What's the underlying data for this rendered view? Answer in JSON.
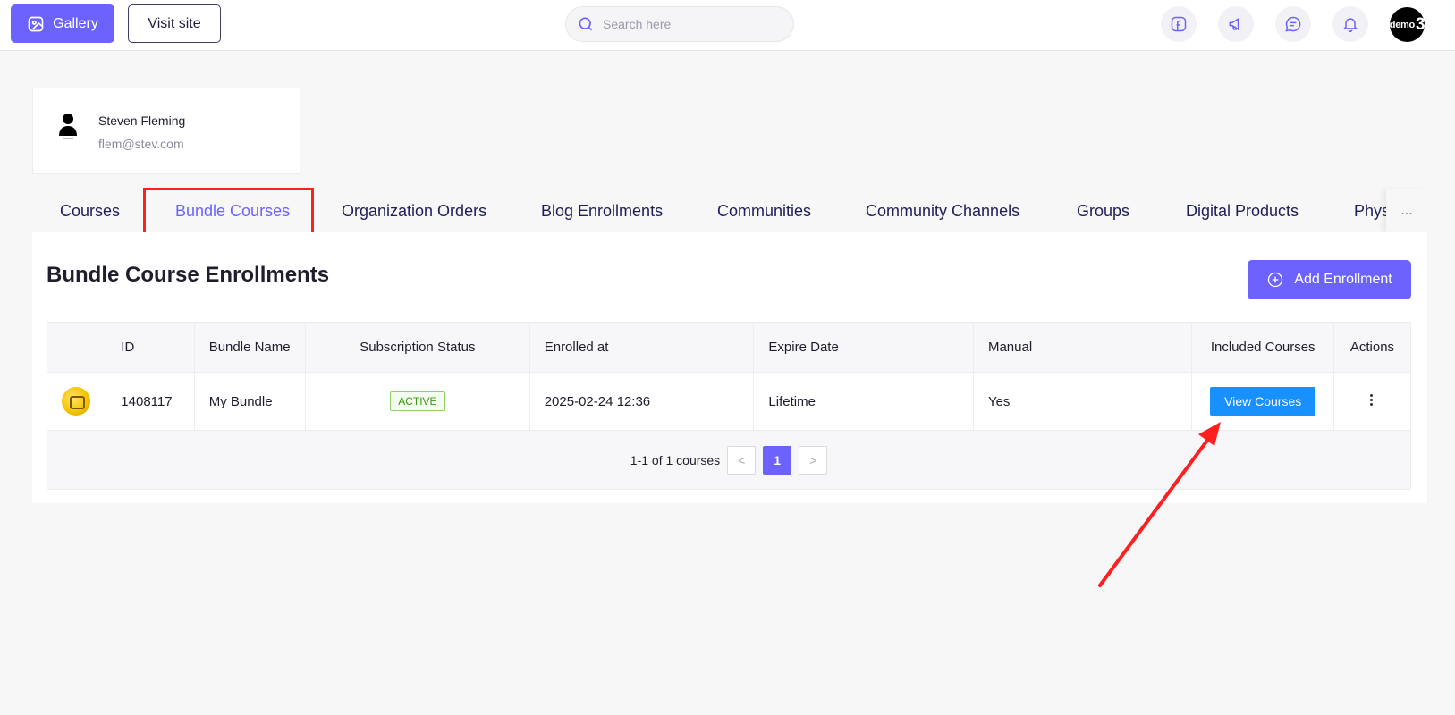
{
  "topbar": {
    "gallery_label": "Gallery",
    "visit_label": "Visit site",
    "search_placeholder": "Search here",
    "avatar_text": "demo",
    "avatar_digit": "3",
    "icons": [
      "facebook-icon",
      "megaphone-icon",
      "chat-icon",
      "bell-icon"
    ]
  },
  "user": {
    "name": "Steven Fleming",
    "email": "flem@stev.com"
  },
  "tabs": [
    {
      "label": "Courses",
      "active": false
    },
    {
      "label": "Bundle Courses",
      "active": true
    },
    {
      "label": "Organization Orders",
      "active": false
    },
    {
      "label": "Blog Enrollments",
      "active": false
    },
    {
      "label": "Communities",
      "active": false
    },
    {
      "label": "Community Channels",
      "active": false
    },
    {
      "label": "Groups",
      "active": false
    },
    {
      "label": "Digital Products",
      "active": false
    },
    {
      "label": "Phys",
      "active": false
    }
  ],
  "tabs_more": "...",
  "panel": {
    "title": "Bundle Course Enrollments",
    "add_label": "Add Enrollment"
  },
  "table": {
    "headers": [
      "",
      "ID",
      "Bundle Name",
      "Subscription Status",
      "Enrolled at",
      "Expire Date",
      "Manual",
      "Included Courses",
      "Actions"
    ],
    "rows": [
      {
        "id": "1408117",
        "bundle_name": "My Bundle",
        "status": "ACTIVE",
        "enrolled_at": "2025-02-24 12:36",
        "expire_date": "Lifetime",
        "manual": "Yes",
        "included_label": "View Courses"
      }
    ]
  },
  "pagination": {
    "summary": "1-1 of 1 courses",
    "current": "1",
    "prev": "<",
    "next": ">"
  },
  "colors": {
    "accent": "#6c63ff",
    "view_button": "#1890ff",
    "annotation": "#ff1f1f"
  }
}
